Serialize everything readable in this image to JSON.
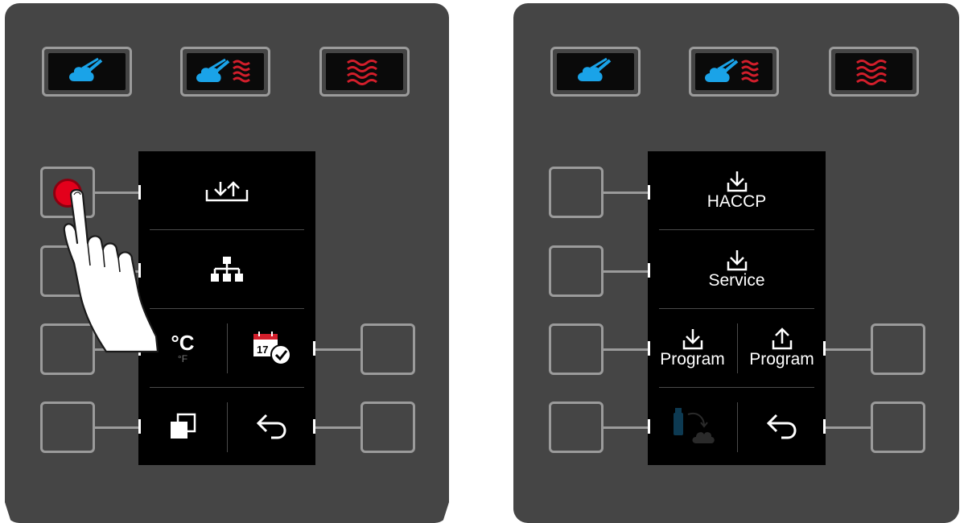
{
  "left_panel": {
    "mode_buttons": [
      "steam-icon",
      "combi-steam-convection-icon",
      "convection-icon"
    ],
    "screen": {
      "rows": [
        {
          "icon": "import-export-icon"
        },
        {
          "icon": "network-icon"
        },
        {
          "cells": [
            {
              "icon": "temperature-unit-icon",
              "label": "°C",
              "sublabel": "°F"
            },
            {
              "icon": "calendar-clock-icon",
              "day": "17"
            }
          ]
        },
        {
          "cells": [
            {
              "icon": "copy-icon"
            },
            {
              "icon": "back-icon"
            }
          ]
        }
      ]
    },
    "pressed_button": "left-side-button-1",
    "hand_icon": "pointing-hand-icon"
  },
  "right_panel": {
    "mode_buttons": [
      "steam-icon",
      "combi-steam-convection-icon",
      "convection-icon"
    ],
    "screen": {
      "haccp_label": "HACCP",
      "service_label": "Service",
      "program_download_label": "Program",
      "program_upload_label": "Program",
      "usb_cloud_icon": "usb-to-cloud-icon",
      "back_icon": "back-icon"
    }
  },
  "colors": {
    "panel": "#454545",
    "button_border": "#9b9b9b",
    "steam_blue": "#1aa3e8",
    "heat_red": "#d21e2b",
    "screen": "#000000",
    "pressed_red": "#e3001b"
  }
}
